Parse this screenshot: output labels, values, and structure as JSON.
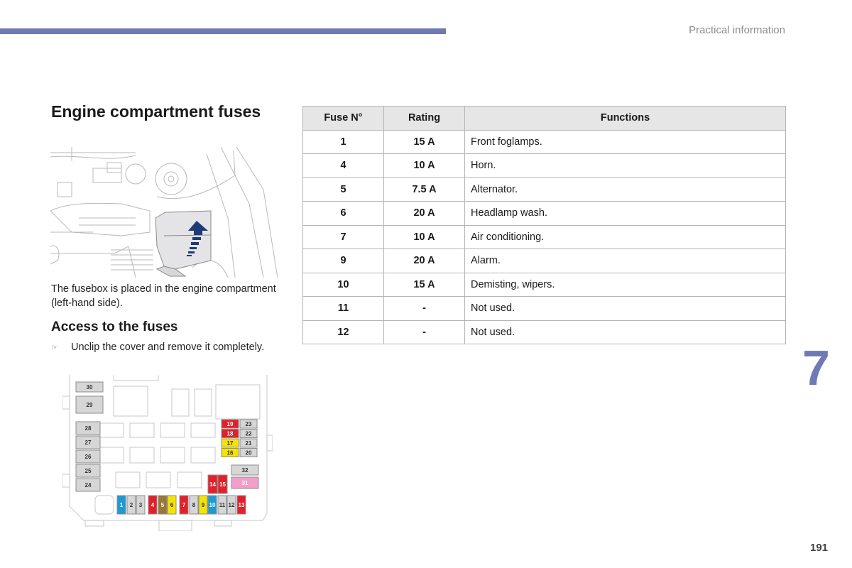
{
  "header": {
    "section_label": "Practical information",
    "accent_color": "#6f79b4"
  },
  "page_title": "Engine compartment fuses",
  "illustration": {
    "icon": "engine-bay-fusebox-illustration",
    "arrow_icon": "lift-arrow-icon"
  },
  "caption": "The fusebox is placed in the engine compartment (left-hand side).",
  "access": {
    "heading": "Access to the fuses",
    "bullet_icon": "pointing-hand-icon",
    "bullet_glyph": "☞",
    "instruction": "Unclip the cover and remove it completely."
  },
  "fuse_diagram": {
    "colors": {
      "blue": "#1b9ad6",
      "grey": "#d6d6d6",
      "red": "#e3202a",
      "brown": "#9b7634",
      "yellow": "#f4e400",
      "pink": "#f19ec8"
    },
    "left_column": [
      "30",
      "29",
      "28",
      "27",
      "26",
      "25",
      "24"
    ],
    "right_block": [
      {
        "label": "19",
        "color": "red"
      },
      {
        "label": "23",
        "color": "grey"
      },
      {
        "label": "18",
        "color": "red"
      },
      {
        "label": "22",
        "color": "grey"
      },
      {
        "label": "17",
        "color": "yellow"
      },
      {
        "label": "21",
        "color": "grey"
      },
      {
        "label": "16",
        "color": "yellow"
      },
      {
        "label": "20",
        "color": "grey"
      }
    ],
    "large_fuses": [
      {
        "label": "32",
        "color": "grey"
      },
      {
        "label": "31",
        "color": "pink"
      }
    ],
    "mid_fuses": [
      {
        "label": "14",
        "color": "red"
      },
      {
        "label": "15",
        "color": "red"
      }
    ],
    "bottom_row": [
      {
        "label": "1",
        "color": "blue"
      },
      {
        "label": "2",
        "color": "grey"
      },
      {
        "label": "3",
        "color": "grey"
      },
      {
        "label": "4",
        "color": "red"
      },
      {
        "label": "5",
        "color": "brown"
      },
      {
        "label": "6",
        "color": "yellow"
      },
      {
        "label": "7",
        "color": "red"
      },
      {
        "label": "8",
        "color": "grey"
      },
      {
        "label": "9",
        "color": "yellow"
      },
      {
        "label": "10",
        "color": "blue"
      },
      {
        "label": "11",
        "color": "grey"
      },
      {
        "label": "12",
        "color": "grey"
      },
      {
        "label": "13",
        "color": "red"
      }
    ]
  },
  "table": {
    "headers": [
      "Fuse N°",
      "Rating",
      "Functions"
    ],
    "rows": [
      {
        "fuse": "1",
        "rating": "15 A",
        "function": "Front foglamps."
      },
      {
        "fuse": "4",
        "rating": "10 A",
        "function": "Horn."
      },
      {
        "fuse": "5",
        "rating": "7.5 A",
        "function": "Alternator."
      },
      {
        "fuse": "6",
        "rating": "20 A",
        "function": "Headlamp wash."
      },
      {
        "fuse": "7",
        "rating": "10 A",
        "function": "Air conditioning."
      },
      {
        "fuse": "9",
        "rating": "20 A",
        "function": "Alarm."
      },
      {
        "fuse": "10",
        "rating": "15 A",
        "function": "Demisting, wipers."
      },
      {
        "fuse": "11",
        "rating": "-",
        "function": "Not used."
      },
      {
        "fuse": "12",
        "rating": "-",
        "function": "Not used."
      }
    ]
  },
  "chapter_number": "7",
  "page_number": "191"
}
